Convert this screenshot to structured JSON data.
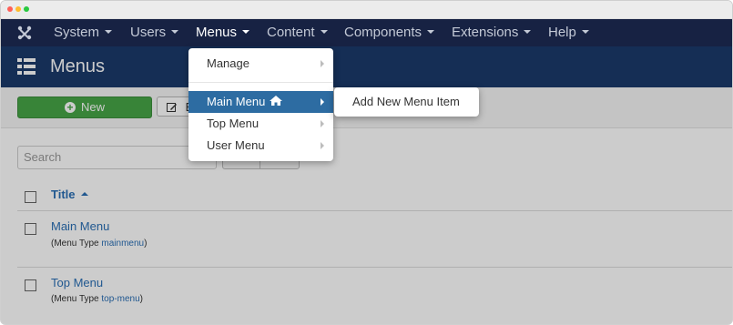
{
  "nav": {
    "items": [
      {
        "label": "System"
      },
      {
        "label": "Users"
      },
      {
        "label": "Menus"
      },
      {
        "label": "Content"
      },
      {
        "label": "Components"
      },
      {
        "label": "Extensions"
      },
      {
        "label": "Help"
      }
    ],
    "active": "Menus"
  },
  "header": {
    "title": "Menus",
    "icon": "list-icon"
  },
  "toolbar": {
    "new_label": "New",
    "edit_label": "E"
  },
  "search": {
    "placeholder": "Search"
  },
  "table": {
    "column_title": "Title",
    "rows": [
      {
        "title": "Main Menu",
        "type_prefix": "(Menu Type ",
        "type_value": "mainmenu",
        "type_suffix": ")"
      },
      {
        "title": "Top Menu",
        "type_prefix": "(Menu Type ",
        "type_value": "top-menu",
        "type_suffix": ")"
      }
    ]
  },
  "dropdown": {
    "items": [
      {
        "label": "Manage"
      },
      {
        "label": "Main Menu",
        "home_icon": "home-icon"
      },
      {
        "label": "Top Menu"
      },
      {
        "label": "User Menu"
      }
    ]
  },
  "submenu": {
    "items": [
      {
        "label": "Add New Menu Item"
      }
    ]
  },
  "colors": {
    "navbar": "#172243",
    "titlebar": "#1b3a6b",
    "highlight": "#2d6ca2",
    "new_button": "#46a546",
    "link": "#2a6fb5"
  }
}
